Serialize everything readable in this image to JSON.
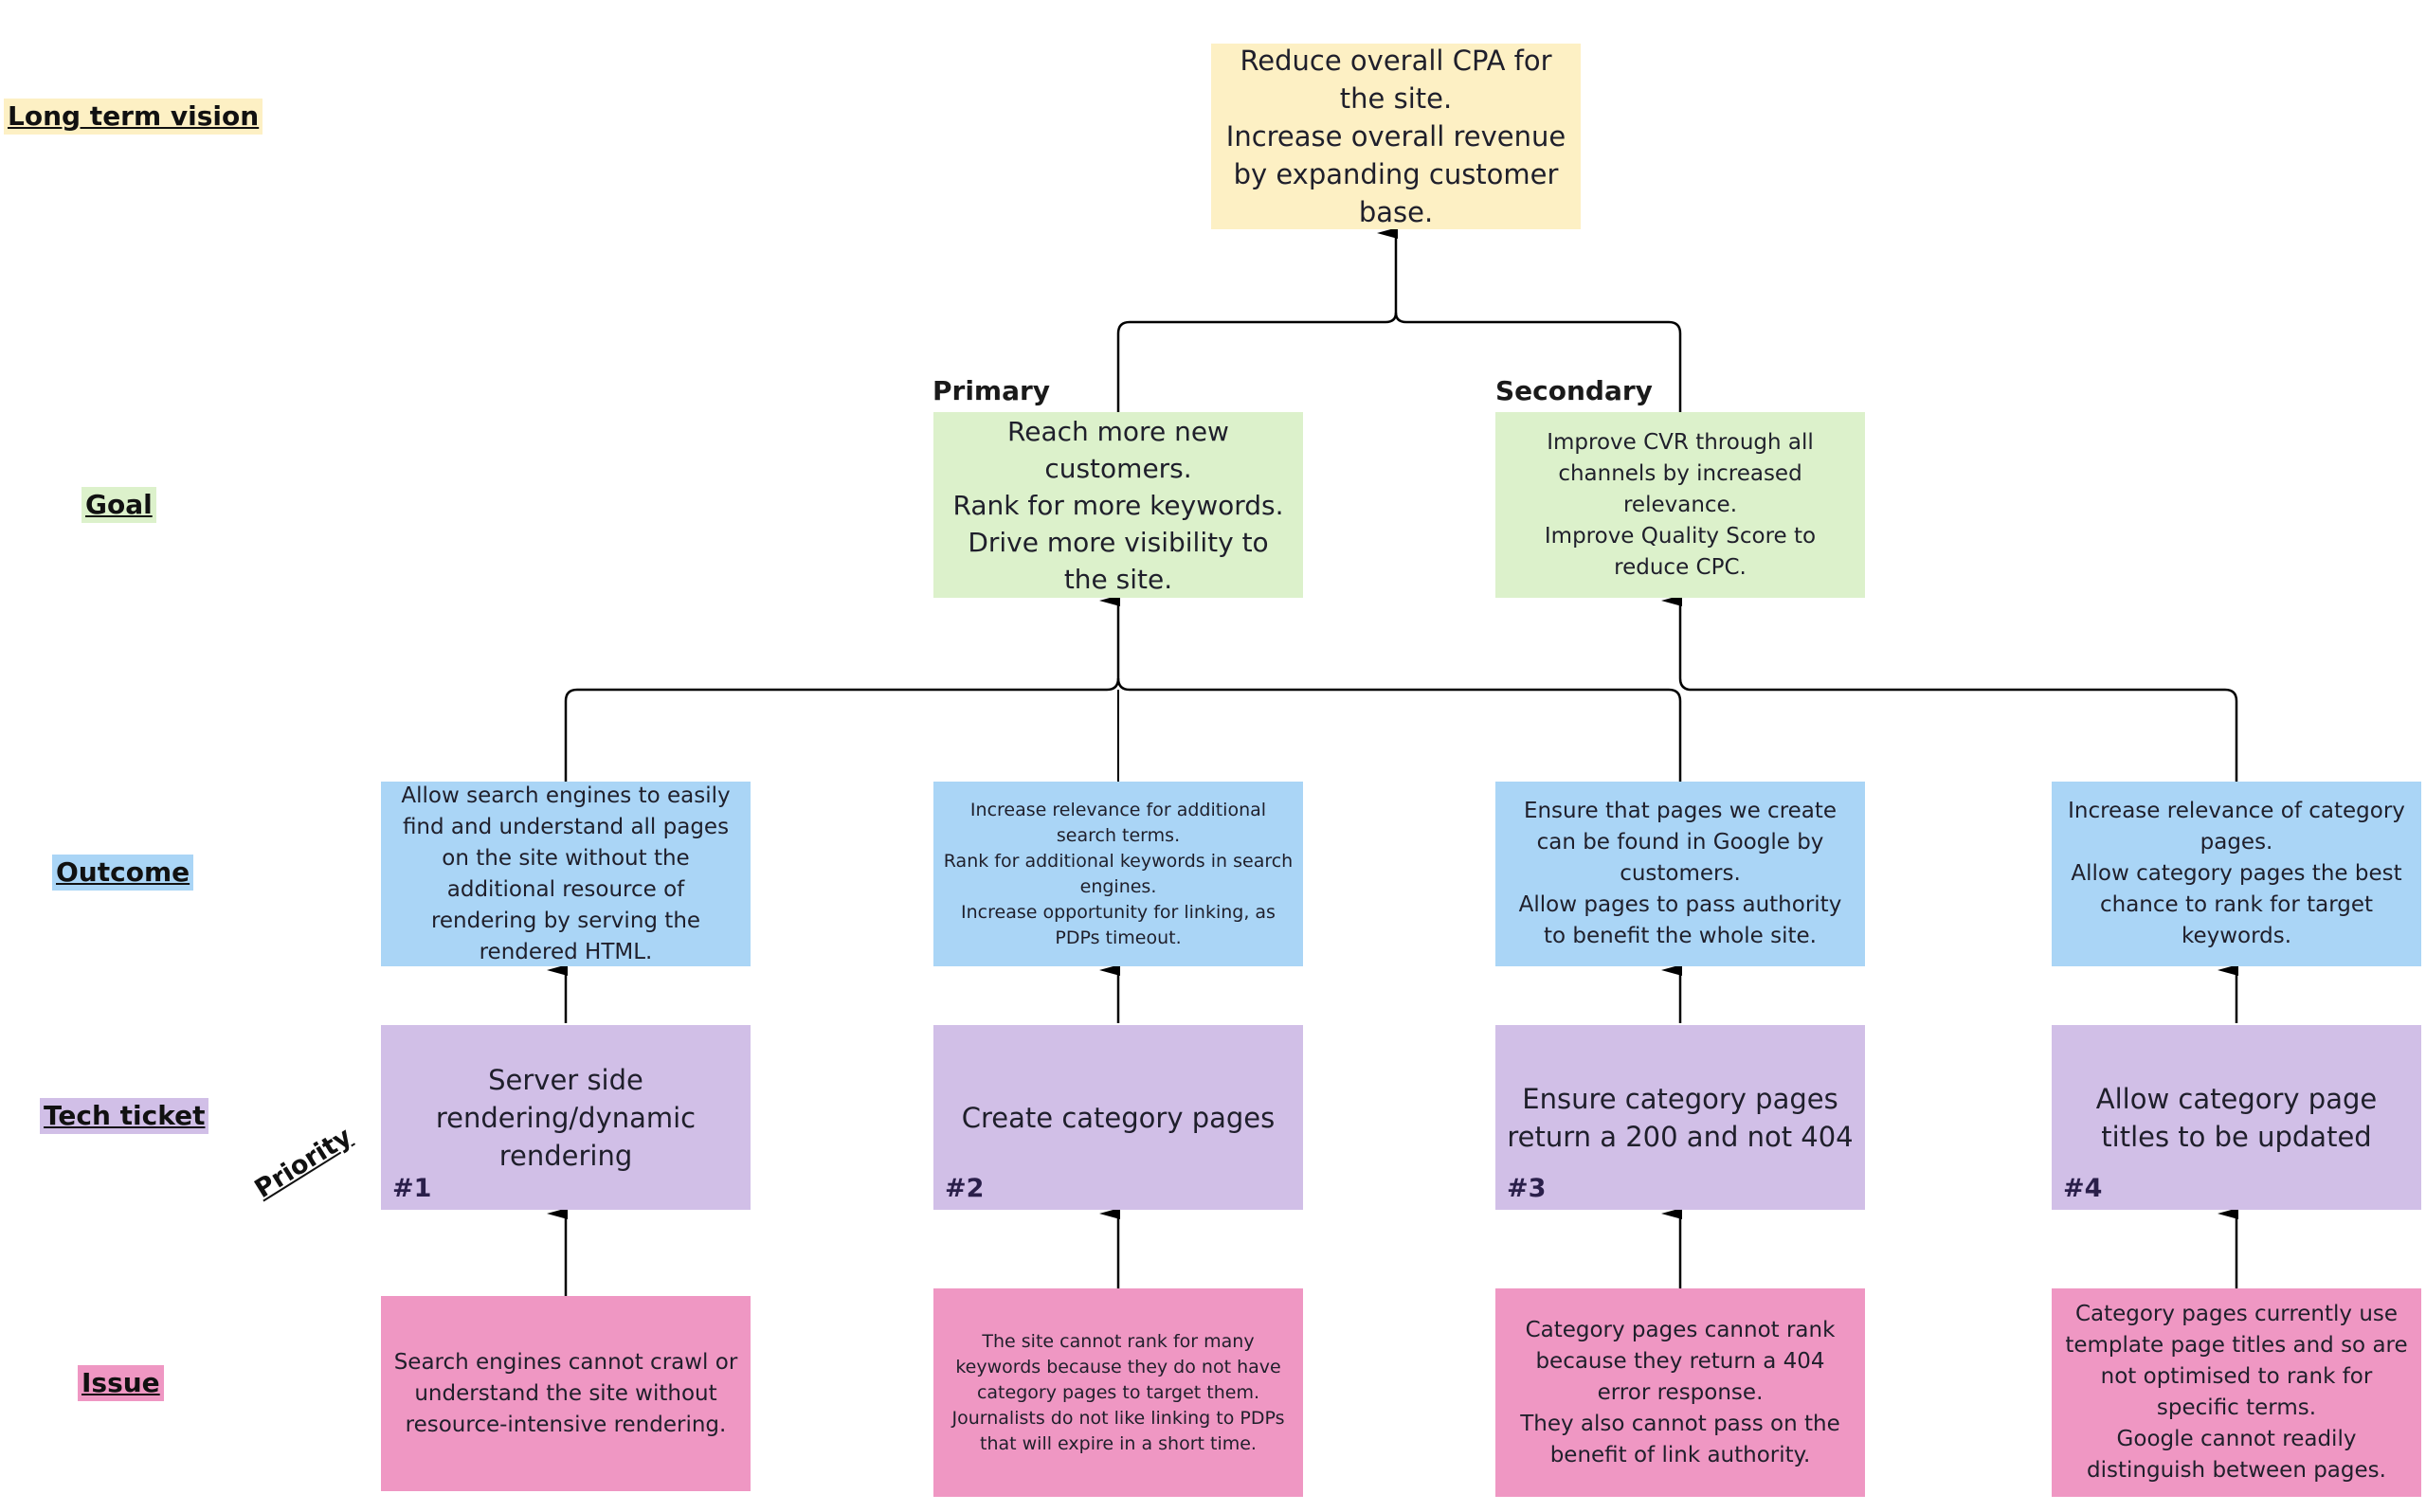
{
  "row_labels": {
    "vision": "Long term vision",
    "goal": "Goal",
    "outcome": "Outcome",
    "tech": "Tech ticket",
    "issue": "Issue"
  },
  "row_colors": {
    "vision": "#fdf0c4",
    "goal": "#dcf1cb",
    "outcome": "#aad5f6",
    "tech": "#d1bfe7",
    "issue": "#ef97c3"
  },
  "vision": {
    "text": "Reduce overall CPA for the site.\nIncrease overall revenue by expanding customer base."
  },
  "goals": [
    {
      "tag": "Primary",
      "text": "Reach more new customers.\nRank for more keywords.\nDrive more visibility to the site."
    },
    {
      "tag": "Secondary",
      "text": "Improve CVR through all channels by increased relevance.\nImprove Quality Score to reduce CPC."
    }
  ],
  "priority_label": "Priority",
  "columns": [
    {
      "outcome": "Allow search engines to easily find and understand all pages on the site without the additional resource of rendering by serving the rendered HTML.",
      "tech": "Server side rendering/dynamic rendering",
      "priority": "#1",
      "issue": "Search engines cannot crawl or understand the site without resource-intensive rendering.",
      "feeds_goal": "Primary"
    },
    {
      "outcome": "Increase relevance for additional search terms.\nRank for additional keywords in search engines.\nIncrease opportunity for linking, as PDPs timeout.",
      "tech": "Create category pages",
      "priority": "#2",
      "issue": "The site cannot rank for many keywords because they do not have category pages to target them.\nJournalists do not like linking to PDPs that will expire in a short time.",
      "feeds_goal": "Primary"
    },
    {
      "outcome": "Ensure that pages we create can be found in Google by customers.\nAllow pages to pass authority to benefit the whole site.",
      "tech": "Ensure category pages return a 200 and not 404",
      "priority": "#3",
      "issue": "Category pages cannot rank because they return a 404 error response.\nThey also cannot pass on the benefit of link authority.",
      "feeds_goal": "Primary"
    },
    {
      "outcome": "Increase relevance of category pages.\nAllow category pages the best chance to rank for target keywords.",
      "tech": "Allow category page titles to be updated",
      "priority": "#4",
      "issue": "Category pages currently use template page titles and so are not optimised to rank for specific terms.\nGoogle cannot readily distinguish between pages.",
      "feeds_goal": "Secondary"
    }
  ]
}
